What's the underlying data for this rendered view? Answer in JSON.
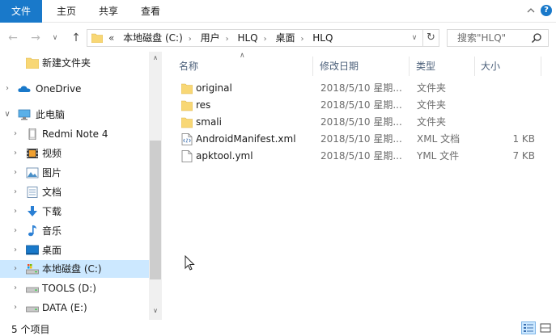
{
  "ribbon": {
    "tabs": [
      "文件",
      "主页",
      "共享",
      "查看"
    ],
    "help_label": "?"
  },
  "address": {
    "overflow": "«",
    "crumbs": [
      "本地磁盘 (C:)",
      "用户",
      "HLQ",
      "桌面",
      "HLQ"
    ]
  },
  "search": {
    "placeholder": "搜索\"HLQ\""
  },
  "sidebar": {
    "items": [
      {
        "label": "新建文件夹",
        "icon": "folder-icon"
      },
      {
        "label": "OneDrive",
        "icon": "cloud-icon"
      },
      {
        "label": "此电脑",
        "icon": "computer-icon"
      },
      {
        "label": "Redmi Note 4",
        "icon": "phone-icon"
      },
      {
        "label": "视频",
        "icon": "video-icon"
      },
      {
        "label": "图片",
        "icon": "pictures-icon"
      },
      {
        "label": "文档",
        "icon": "documents-icon"
      },
      {
        "label": "下载",
        "icon": "download-icon"
      },
      {
        "label": "音乐",
        "icon": "music-icon"
      },
      {
        "label": "桌面",
        "icon": "desktop-icon"
      },
      {
        "label": "本地磁盘 (C:)",
        "icon": "system-drive-icon"
      },
      {
        "label": "TOOLS (D:)",
        "icon": "drive-icon"
      },
      {
        "label": "DATA (E:)",
        "icon": "drive-icon"
      }
    ]
  },
  "file_list": {
    "columns": [
      "名称",
      "修改日期",
      "类型",
      "大小"
    ],
    "rows": [
      {
        "name": "original",
        "date": "2018/5/10 星期...",
        "type": "文件夹",
        "size": "",
        "icon": "folder-icon"
      },
      {
        "name": "res",
        "date": "2018/5/10 星期...",
        "type": "文件夹",
        "size": "",
        "icon": "folder-icon"
      },
      {
        "name": "smali",
        "date": "2018/5/10 星期...",
        "type": "文件夹",
        "size": "",
        "icon": "folder-icon"
      },
      {
        "name": "AndroidManifest.xml",
        "date": "2018/5/10 星期...",
        "type": "XML 文档",
        "size": "1 KB",
        "icon": "xml-file-icon"
      },
      {
        "name": "apktool.yml",
        "date": "2018/5/10 星期...",
        "type": "YML 文件",
        "size": "7 KB",
        "icon": "file-icon"
      }
    ]
  },
  "status": {
    "item_count": "5 个项目"
  },
  "colors": {
    "accent": "#1979ca",
    "selection": "#cce8ff",
    "folder": "#f8d775",
    "header_text": "#4c607a"
  }
}
